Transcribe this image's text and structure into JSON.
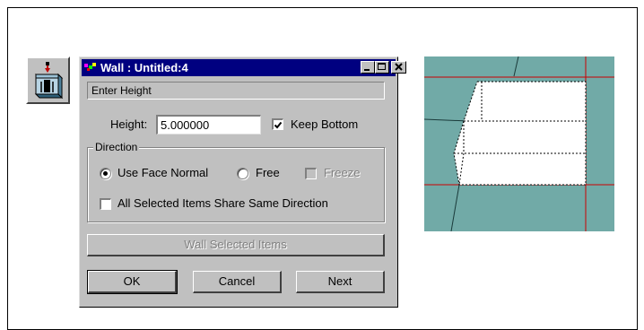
{
  "dialog": {
    "title": "Wall : Untitled:4",
    "prompt": "Enter Height",
    "height_label": "Height:",
    "height_value": "5.000000",
    "keep_bottom_label": "Keep Bottom",
    "keep_bottom_checked": true,
    "direction_group": "Direction",
    "use_face_normal_label": "Use Face Normal",
    "free_label": "Free",
    "freeze_label": "Freeze",
    "share_direction_label": "All Selected Items Share Same Direction",
    "wall_selected_button": "Wall Selected Items",
    "ok_button": "OK",
    "cancel_button": "Cancel",
    "next_button": "Next"
  },
  "icons": {
    "tool": "wall-tool-icon",
    "minimize": "minimize-icon",
    "maximize": "maximize-icon",
    "close": "close-icon"
  },
  "colors": {
    "titlebar": "#000080",
    "dialog": "#c0c0c0",
    "viewport": "#71aaa7",
    "grid_dark": "#1a3a3a",
    "grid_red": "#cc0000"
  }
}
